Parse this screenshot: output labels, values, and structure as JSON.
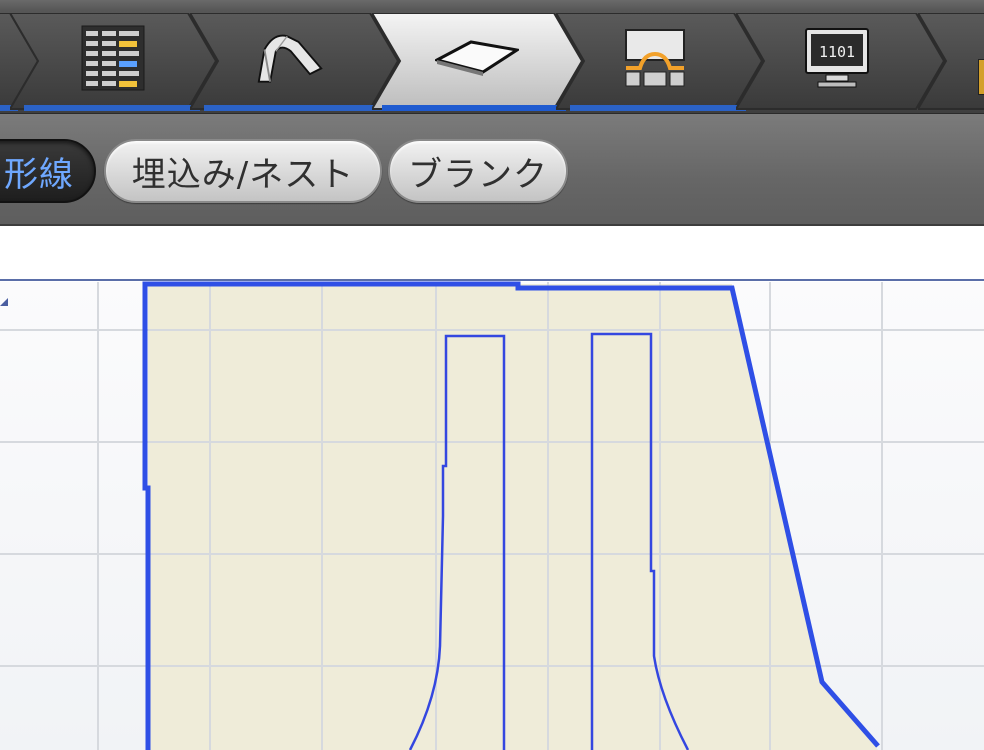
{
  "workflow_steps": [
    {
      "icon": "partial-left-step",
      "underline": true
    },
    {
      "icon": "layer-list-icon",
      "underline": true
    },
    {
      "icon": "curved-sheet-icon",
      "underline": true
    },
    {
      "icon": "flat-sheet-icon",
      "underline": true,
      "selected": true
    },
    {
      "icon": "toolpath-icon",
      "underline": true
    },
    {
      "icon": "monitor-1101-icon",
      "label": "1101",
      "underline": false
    },
    {
      "icon": "partial-right-step",
      "underline": false
    }
  ],
  "tabs": [
    {
      "label": "形線",
      "active": true
    },
    {
      "label": "埋込み/ネスト",
      "active": false
    },
    {
      "label": "ブランク",
      "active": false
    }
  ],
  "colors": {
    "accent_blue": "#2b62c6",
    "outline_blue": "#2f4fe6",
    "part_fill": "#efecd9",
    "grid": "#d9dbe0",
    "active_tab_text": "#6fa8ff"
  }
}
